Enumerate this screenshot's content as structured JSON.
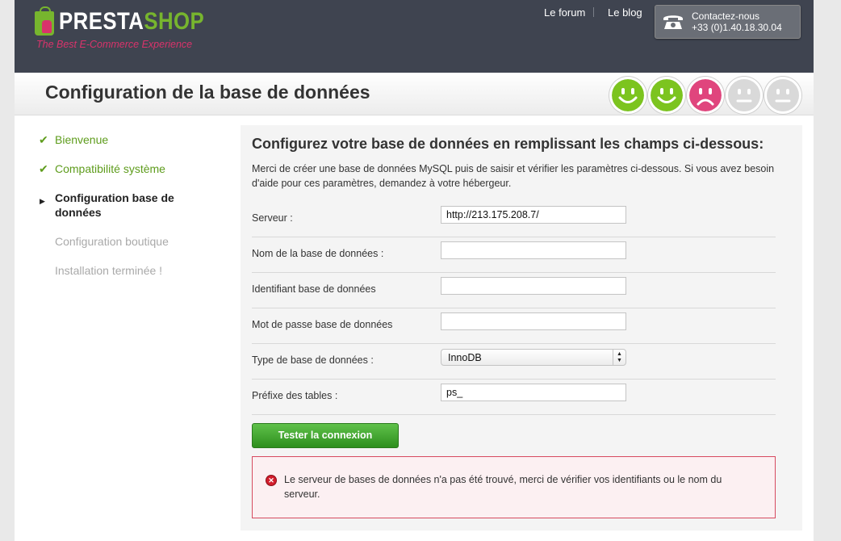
{
  "header": {
    "logo_text_presta": "PRESTA",
    "logo_text_shop": "SHOP",
    "tagline": "The Best E-Commerce Experience",
    "nav": {
      "forum": "Le forum",
      "blog": "Le blog"
    },
    "contact": {
      "label": "Contactez-nous",
      "phone": "+33 (0)1.40.18.30.04"
    }
  },
  "titlebar": {
    "title": "Configuration de la base de données",
    "faces": [
      {
        "mood": "happy",
        "color": "#7cc41f"
      },
      {
        "mood": "happy",
        "color": "#7cc41f"
      },
      {
        "mood": "sad",
        "color": "#e0457d"
      },
      {
        "mood": "neutral",
        "color": "#d9d9d9"
      },
      {
        "mood": "neutral",
        "color": "#d9d9d9"
      }
    ]
  },
  "sidebar": {
    "steps": [
      {
        "label": "Bienvenue",
        "state": "done"
      },
      {
        "label": "Compatibilité système",
        "state": "done"
      },
      {
        "label": "Configuration base de données",
        "state": "current"
      },
      {
        "label": "Configuration boutique",
        "state": "todo"
      },
      {
        "label": "Installation terminée !",
        "state": "todo"
      }
    ]
  },
  "main": {
    "heading": "Configurez votre base de données en remplissant les champs ci-dessous:",
    "description": "Merci de créer une base de données MySQL puis de saisir et vérifier les paramètres ci-dessous. Si vous avez besoin d'aide pour ces paramètres, demandez à votre hébergeur.",
    "fields": {
      "server": {
        "label": "Serveur :",
        "value": "http://213.175.208.7/"
      },
      "db_name": {
        "label": "Nom de la base de données :",
        "value": ""
      },
      "db_user": {
        "label": "Identifiant base de données",
        "value": ""
      },
      "db_password": {
        "label": "Mot de passe base de données",
        "value": ""
      },
      "db_type": {
        "label": "Type de base de données :",
        "value": "InnoDB"
      },
      "table_prefix": {
        "label": "Préfixe des tables :",
        "value": "ps_"
      }
    },
    "test_button": "Tester la connexion",
    "error": "Le serveur de bases de données n'a pas été trouvé, merci de vérifier vos identifiants ou le nom du serveur."
  },
  "colors": {
    "header_bg": "#3f4450",
    "accent_green": "#77b52e",
    "accent_pink": "#d9336b",
    "error_border": "#d64a5f"
  }
}
